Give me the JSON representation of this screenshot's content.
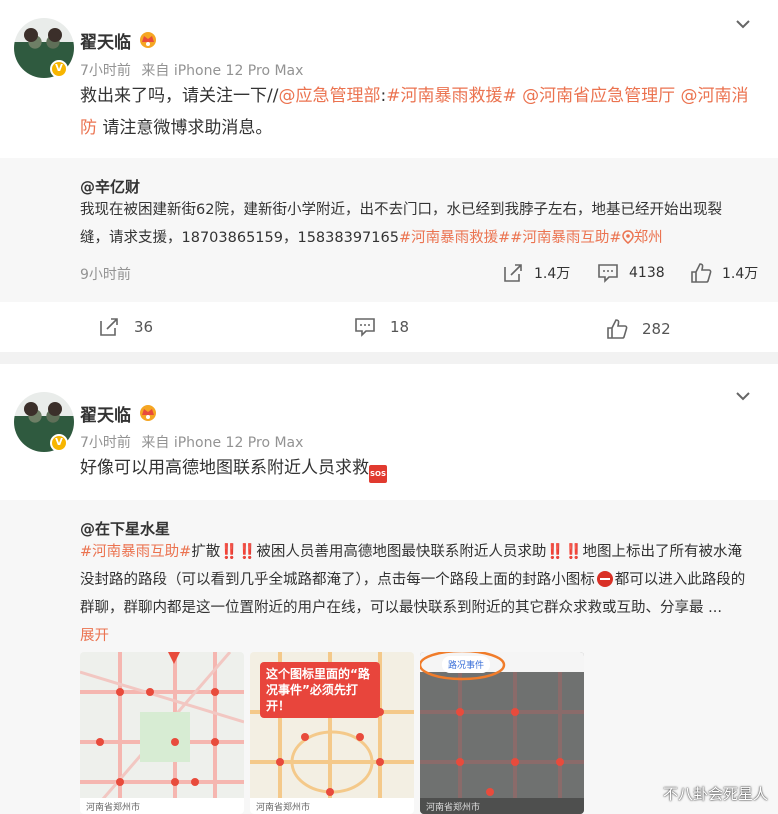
{
  "post1": {
    "username": "翟天临",
    "time": "7小时前",
    "source": "来自 iPhone 12 Pro Max",
    "content": {
      "lead": "救出来了吗，请关注一下//",
      "mention1": "@应急管理部",
      "colon": ":",
      "tag1": "#河南暴雨救援#",
      "mention2": "@河南省应急管理厅",
      "mention3": "@河南消防",
      "tail": " 请注意微博求助消息。"
    },
    "repost": {
      "author": "@辛亿财",
      "text": "我现在被困建新街62院，建新街小学附近，出不去门口，水已经到我脖子左右，地基已经开始出现裂缝，请求支援，18703865159，15838397165",
      "tag1": "#河南暴雨救援#",
      "tag2": "#河南暴雨互助#",
      "location": "郑州",
      "time": "9小时前",
      "share_count": "1.4万",
      "comment_count": "4138",
      "like_count": "1.4万"
    },
    "actions": {
      "share": "36",
      "comment": "18",
      "like": "282"
    }
  },
  "post2": {
    "username": "翟天临",
    "time": "7小时前",
    "source": "来自 iPhone 12 Pro Max",
    "content": "好像可以用高德地图联系附近人员求救",
    "repost": {
      "author": "@在下星水星",
      "tag": "#河南暴雨互助#",
      "text_a": "扩散‼️‼️被困人员善用高德地图最快联系附近人员求助‼️‼️地图上标出了所有被水淹没封路的路段（可以看到几乎全城路都淹了），点击每一个路段上面的封路小图标",
      "text_b": "都可以进入此路段的群聊，群聊内都是这一位置附近的用户在线，可以最快联系到附近的其它群众求救或互助、分享最 ...",
      "expand": "展开",
      "thumbs": [
        {
          "footer": "河南省郑州市"
        },
        {
          "callout": "这个图标里面的“路况事件”必须先打开！",
          "footer": "河南省郑州市"
        },
        {
          "tag": "路况事件",
          "footer": "河南省郑州市"
        }
      ]
    }
  },
  "watermark": "不八卦会死星人",
  "colors": {
    "link": "#eb7350",
    "badge": "#f7b500",
    "background": "#f2f2f2"
  },
  "icons": [
    "verified-badge",
    "crown-icon",
    "chevron-down-icon",
    "share-icon",
    "comment-icon",
    "like-icon",
    "location-pin-icon",
    "sos-icon",
    "no-entry-icon"
  ]
}
